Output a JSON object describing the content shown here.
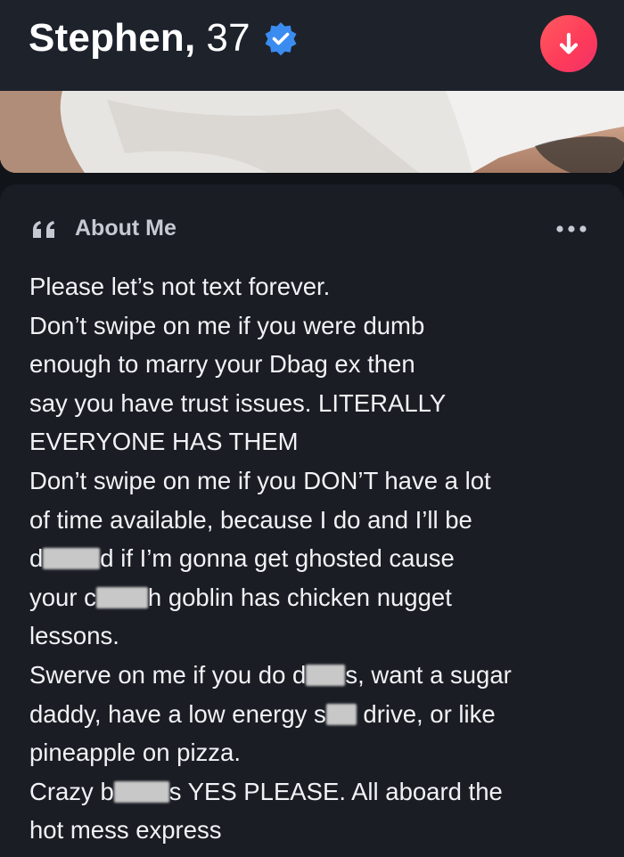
{
  "profile": {
    "name": "Stephen,",
    "age": "37"
  },
  "about": {
    "heading": "About Me",
    "bio_lines": [
      [
        "Please let’s not text forever."
      ],
      [
        "Don’t swipe on me if you were dumb"
      ],
      [
        "enough to marry your Dbag ex then"
      ],
      [
        "say you have trust issues. LITERALLY"
      ],
      [
        "EVERYONE HAS THEM"
      ],
      [
        "Don’t swipe on me if you DON’T have a lot"
      ],
      [
        "of time available, because I do and I’ll be"
      ],
      [
        "d",
        "d if I’m gonna get ghosted cause"
      ],
      [
        "your c",
        "h goblin has chicken nugget"
      ],
      [
        "lessons."
      ],
      [
        "Swerve on me if you do d",
        "s, want a sugar"
      ],
      [
        "daddy, have a low energy s",
        " drive, or like"
      ],
      [
        "pineapple on pizza."
      ],
      [
        "Crazy b",
        "s YES PLEASE. All aboard the"
      ],
      [
        "hot mess express"
      ]
    ]
  },
  "colors": {
    "background": "#111418",
    "header": "#1d222b",
    "verified_badge": "#3b8cf0",
    "down_button": "#fd3a5a",
    "text": "#f1f2f5",
    "subtle_text": "#c5c9d2"
  },
  "icons": {
    "verified": "verified-badge-icon",
    "down": "arrow-down-icon",
    "quote": "quote-icon",
    "more": "more-dots-icon"
  }
}
